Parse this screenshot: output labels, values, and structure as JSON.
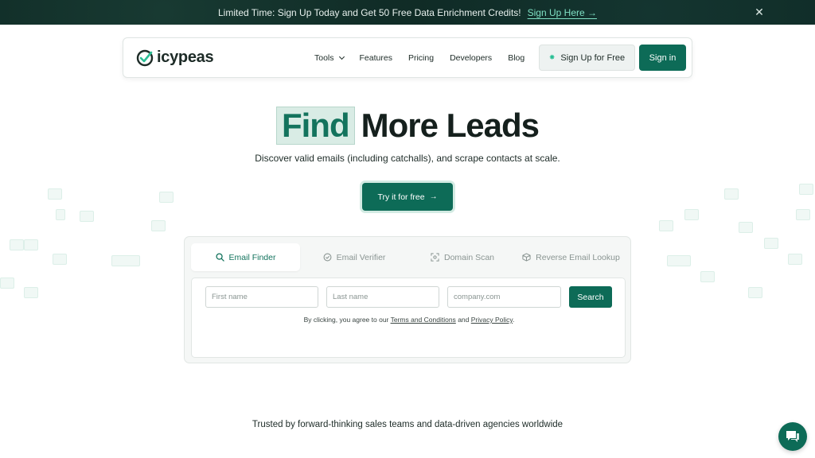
{
  "announcement": {
    "text": "Limited Time: Sign Up Today and Get 50 Free Data Enrichment Credits!",
    "link": "Sign Up Here →",
    "close_icon": "close-icon"
  },
  "nav": {
    "brand": "icypeas",
    "links": [
      {
        "label": "Tools",
        "has_dropdown": true
      },
      {
        "label": "Features"
      },
      {
        "label": "Pricing"
      },
      {
        "label": "Developers"
      },
      {
        "label": "Blog"
      }
    ],
    "signup_label": "Sign Up for Free",
    "signin_label": "Sign in"
  },
  "hero": {
    "highlight": "Find",
    "title_rest": "More Leads",
    "subtitle": "Discover valid emails (including catchalls), and scrape contacts at scale.",
    "cta": "Try it for free",
    "cta_icon": "arrow-right-icon"
  },
  "tool": {
    "tabs": [
      {
        "label": "Email Finder",
        "icon": "search-icon",
        "active": true
      },
      {
        "label": "Email Verifier",
        "icon": "check-circle-icon",
        "active": false
      },
      {
        "label": "Domain Scan",
        "icon": "scan-icon",
        "active": false
      },
      {
        "label": "Reverse Email Lookup",
        "icon": "cube-icon",
        "active": false
      }
    ],
    "fields": {
      "first_name_placeholder": "First name",
      "last_name_placeholder": "Last name",
      "company_placeholder": "company.com"
    },
    "search_label": "Search",
    "consent": {
      "prefix": "By clicking, you agree to our",
      "terms": "Terms and Conditions",
      "and": "and",
      "privacy": "Privacy Policy",
      "suffix": "."
    }
  },
  "trusted": "Trusted by forward-thinking sales teams and data-driven agencies worldwide",
  "colors": {
    "brand": "#0d6b57",
    "announcement_bg": "#0f2a25",
    "highlight_bg": "#d9ece5"
  }
}
